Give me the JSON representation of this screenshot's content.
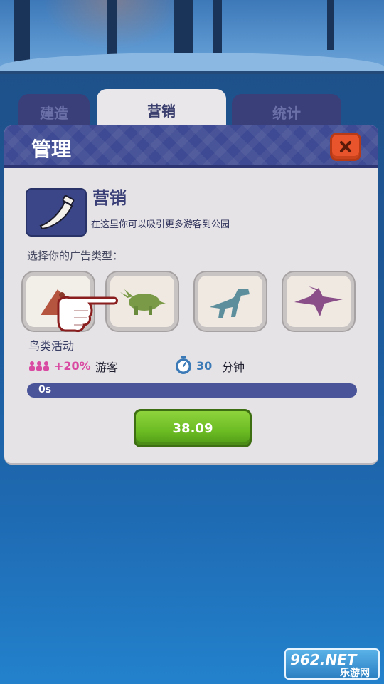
{
  "tabs": [
    {
      "label": "建造",
      "active": false
    },
    {
      "label": "营销",
      "active": true
    },
    {
      "label": "统计",
      "active": false
    }
  ],
  "panel": {
    "title": "管理",
    "close_icon": "close-x-icon"
  },
  "section": {
    "title": "营销",
    "description": "在这里你可以吸引更多游客到公园",
    "icon": "horn-icon"
  },
  "ads": {
    "label": "选择你的广告类型：",
    "cards": [
      {
        "icon": "bird-dinosaur-icon",
        "selected": true
      },
      {
        "icon": "triceratops-icon",
        "selected": false
      },
      {
        "icon": "raptor-icon",
        "selected": false
      },
      {
        "icon": "pterodactyl-icon",
        "selected": false
      }
    ],
    "selected_name": "鸟类活动"
  },
  "stats": {
    "visitors_pct": "+20%",
    "visitors_label": "游客",
    "duration_value": "30",
    "duration_unit": "分钟"
  },
  "progress": {
    "text": "0s",
    "fraction": 0
  },
  "buy_button": {
    "label": "38.09"
  },
  "watermark": {
    "top": "962.NET",
    "bottom": "乐游网"
  },
  "colors": {
    "accent_blue": "#3e4a93",
    "buy_green": "#6bbb23",
    "close_orange": "#e8542b",
    "visitors_pink": "#d94ba2"
  }
}
